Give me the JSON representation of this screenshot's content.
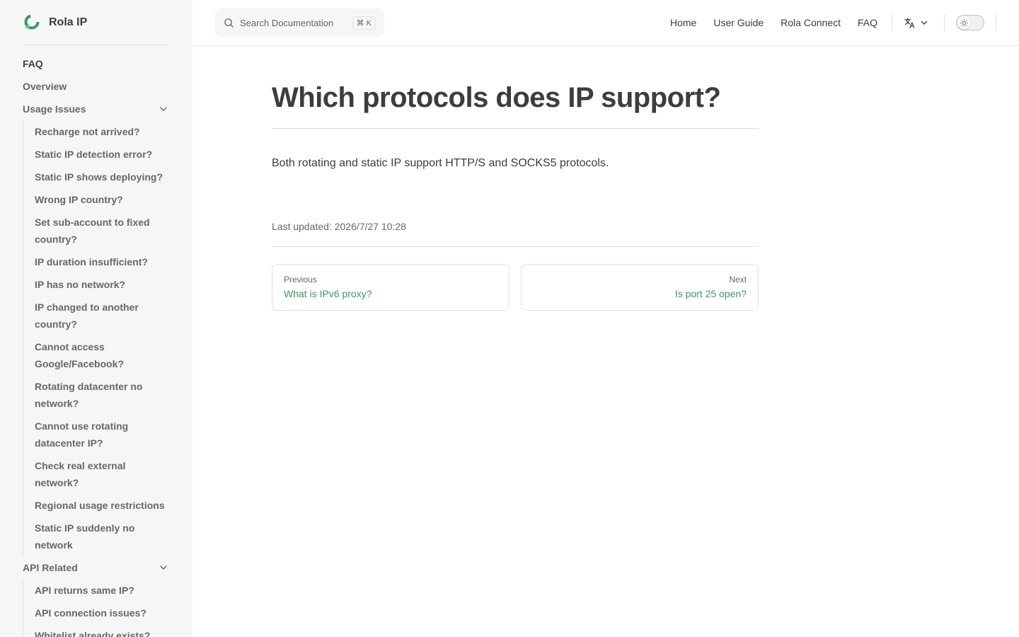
{
  "brand": {
    "name": "Rola IP",
    "accent": "#3b9a62"
  },
  "sidebar": {
    "top_item": "FAQ",
    "overview": "Overview",
    "groups": [
      {
        "label": "Usage Issues",
        "items": [
          "Recharge not arrived?",
          "Static IP detection error?",
          "Static IP shows deploying?",
          "Wrong IP country?",
          "Set sub-account to fixed country?",
          "IP duration insufficient?",
          "IP has no network?",
          "IP changed to another country?",
          "Cannot access Google/Facebook?",
          "Rotating datacenter no network?",
          "Cannot use rotating datacenter IP?",
          "Check real external network?",
          "Regional usage restrictions",
          "Static IP suddenly no network"
        ]
      },
      {
        "label": "API Related",
        "items": [
          "API returns same IP?",
          "API connection issues?",
          "Whitelist already exists?"
        ]
      }
    ]
  },
  "topbar": {
    "search_placeholder": "Search Documentation",
    "search_shortcut": "⌘ K",
    "nav": [
      "Home",
      "User Guide",
      "Rola Connect",
      "FAQ"
    ]
  },
  "page": {
    "title": "Which protocols does IP support?",
    "body": "Both rotating and static IP support HTTP/S and SOCKS5 protocols.",
    "last_updated": "Last updated: 2026/7/27 10:28",
    "prev": {
      "label": "Previous",
      "title": "What is IPv6 proxy?"
    },
    "next": {
      "label": "Next",
      "title": "Is port 25 open?"
    }
  }
}
